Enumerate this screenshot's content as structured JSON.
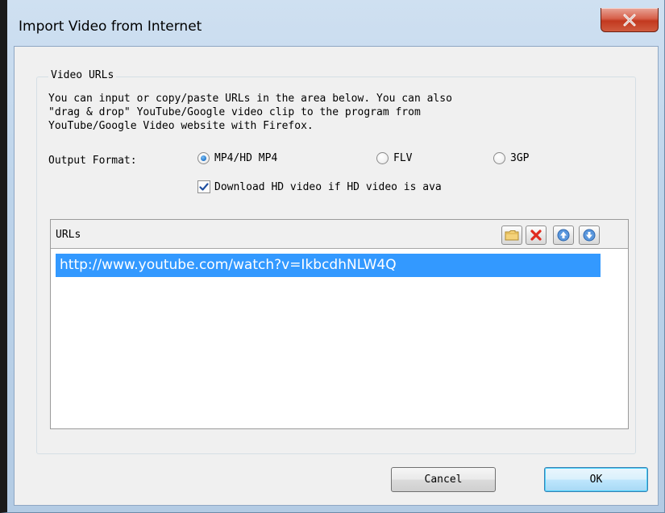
{
  "window": {
    "title": "Import Video from Internet",
    "close_symbol": "x"
  },
  "group": {
    "title": "Video URLs",
    "description": "You can input or copy/paste URLs in the area below. You can also\n\"drag & drop\" YouTube/Google video clip to the program from\nYouTube/Google Video website with Firefox."
  },
  "output_format": {
    "label": "Output Format:",
    "options": [
      {
        "label": "MP4/HD MP4",
        "checked": true
      },
      {
        "label": "FLV",
        "checked": false
      },
      {
        "label": "3GP",
        "checked": false
      }
    ]
  },
  "hd_checkbox": {
    "label": "Download HD video if HD video is ava",
    "checked": true
  },
  "urls": {
    "header": "URLs",
    "toolbar_icons": [
      "folder-icon",
      "delete-icon",
      "arrow-up-icon",
      "arrow-down-icon"
    ],
    "items": [
      "http://www.youtube.com/watch?v=IkbcdhNLW4Q"
    ],
    "selected_color": "#3399ff"
  },
  "buttons": {
    "cancel": "Cancel",
    "ok": "OK"
  }
}
